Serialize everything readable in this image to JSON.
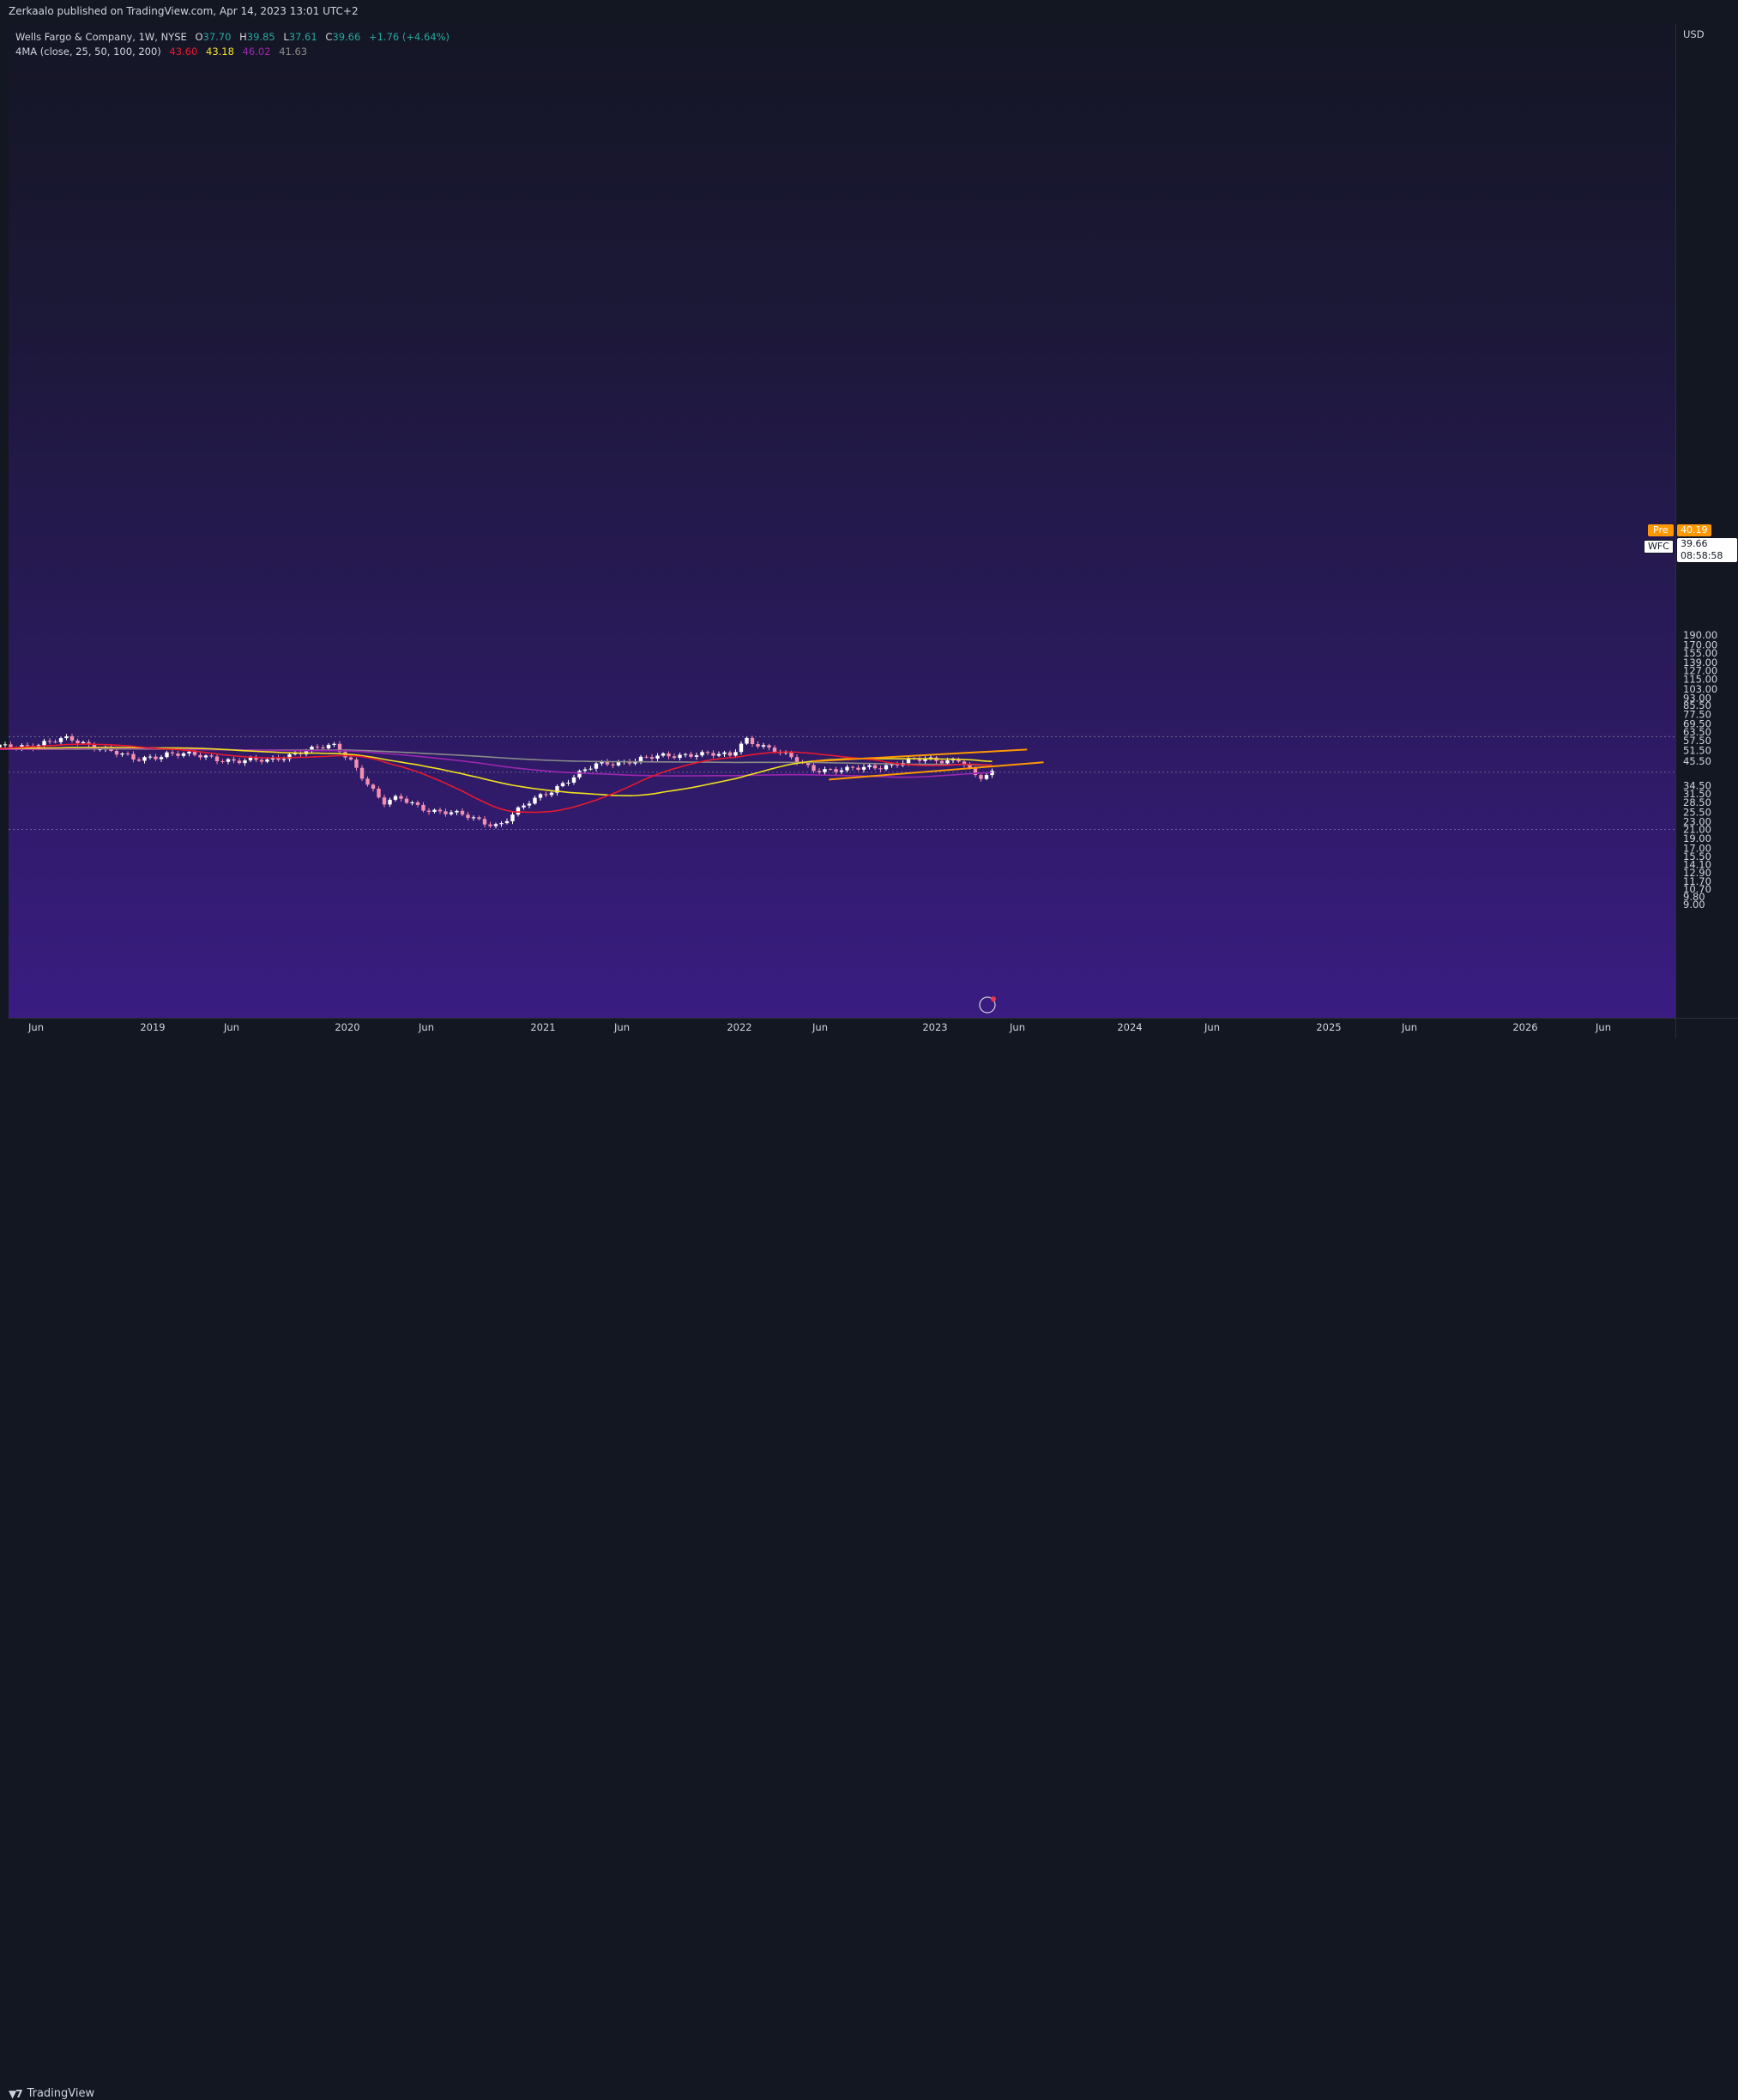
{
  "header": {
    "published": "Zerkaalo published on TradingView.com, Apr 14, 2023 13:01 UTC+2"
  },
  "legend": {
    "symbol": "Wells Fargo & Company, 1W, NYSE",
    "o_label": "O",
    "o_val": "37.70",
    "h_label": "H",
    "h_val": "39.85",
    "l_label": "L",
    "l_val": "37.61",
    "c_label": "C",
    "c_val": "39.66",
    "change": "+1.76 (+4.64%)",
    "ma_label": "4MA (close, 25, 50, 100, 200)",
    "ma_values": [
      "43.60",
      "43.18",
      "46.02",
      "41.63"
    ]
  },
  "colors": {
    "up": "#ffffff",
    "down": "#f48fb1",
    "ma25": "#e8192f",
    "ma50": "#f2e11e",
    "ma100": "#9c27b0",
    "ma200": "#8a8a8a",
    "trend": "#ff9800",
    "pre": "#ff9800"
  },
  "price_scale": {
    "currency": "USD",
    "ticks": [
      "190.00",
      "170.00",
      "155.00",
      "139.00",
      "127.00",
      "115.00",
      "103.00",
      "93.00",
      "85.50",
      "77.50",
      "69.50",
      "63.50",
      "57.50",
      "51.50",
      "45.50",
      "34.50",
      "31.50",
      "28.50",
      "25.50",
      "23.00",
      "21.00",
      "19.00",
      "17.00",
      "15.50",
      "14.10",
      "12.90",
      "11.70",
      "10.70",
      "9.80",
      "9.00"
    ]
  },
  "badges": {
    "pre_label": "Pre",
    "pre_value": "40.19",
    "symbol": "WFC",
    "last_value": "39.66",
    "countdown": "08:58:58"
  },
  "time_scale": [
    "Jun",
    "2019",
    "Jun",
    "2020",
    "Jun",
    "2021",
    "Jun",
    "2022",
    "Jun",
    "2023",
    "Jun",
    "2024",
    "Jun",
    "2025",
    "Jun",
    "2026",
    "Jun"
  ],
  "footer": {
    "brand": "TradingView"
  },
  "chart_data": {
    "type": "candlestick",
    "symbol": "WFC",
    "timeframe": "1W",
    "yscale": "log",
    "ylim": [
      8.5,
      215
    ],
    "x_axis": [
      "Jun",
      "2019",
      "Jun",
      "2020",
      "Jun",
      "2021",
      "Jun",
      "2022",
      "Jun",
      "2023",
      "Jun",
      "2024",
      "Jun",
      "2025",
      "Jun",
      "2026",
      "Jun"
    ],
    "price_path": [
      {
        "date": "2018-04",
        "close": 53.5
      },
      {
        "date": "2018-06",
        "close": 55
      },
      {
        "date": "2018-08",
        "close": 58.5
      },
      {
        "date": "2018-10",
        "close": 53
      },
      {
        "date": "2018-12",
        "close": 46
      },
      {
        "date": "2019-02",
        "close": 50
      },
      {
        "date": "2019-04",
        "close": 48
      },
      {
        "date": "2019-06",
        "close": 46
      },
      {
        "date": "2019-08",
        "close": 45.5
      },
      {
        "date": "2019-10",
        "close": 51
      },
      {
        "date": "2019-12",
        "close": 54
      },
      {
        "date": "2020-01",
        "close": 47
      },
      {
        "date": "2020-03",
        "close": 28
      },
      {
        "date": "2020-04",
        "close": 30
      },
      {
        "date": "2020-06",
        "close": 26
      },
      {
        "date": "2020-08",
        "close": 24.5
      },
      {
        "date": "2020-10",
        "close": 22
      },
      {
        "date": "2020-12",
        "close": 29
      },
      {
        "date": "2021-02",
        "close": 36
      },
      {
        "date": "2021-04",
        "close": 44
      },
      {
        "date": "2021-06",
        "close": 46
      },
      {
        "date": "2021-08",
        "close": 48
      },
      {
        "date": "2021-10",
        "close": 50
      },
      {
        "date": "2021-12",
        "close": 48
      },
      {
        "date": "2022-01",
        "close": 59
      },
      {
        "date": "2022-03",
        "close": 50
      },
      {
        "date": "2022-05",
        "close": 42
      },
      {
        "date": "2022-07",
        "close": 41
      },
      {
        "date": "2022-09",
        "close": 43
      },
      {
        "date": "2022-11",
        "close": 46
      },
      {
        "date": "2023-01",
        "close": 46
      },
      {
        "date": "2023-02",
        "close": 47
      },
      {
        "date": "2023-03",
        "close": 37
      },
      {
        "date": "2023-04",
        "close": 39.66
      }
    ],
    "moving_averages": [
      {
        "length": 25,
        "last": 43.6
      },
      {
        "length": 50,
        "last": 43.18
      },
      {
        "length": 100,
        "last": 46.02
      },
      {
        "length": 200,
        "last": 41.63
      }
    ],
    "horizontal_lines": [
      60.2,
      40.19,
      21.0
    ],
    "trendlines": [
      {
        "from": {
          "date": "2022-05",
          "price": 45.5
        },
        "to": {
          "date": "2023-06",
          "price": 52
        }
      },
      {
        "from": {
          "date": "2022-06",
          "price": 37
        },
        "to": {
          "date": "2023-07",
          "price": 45
        }
      }
    ],
    "grid": false
  }
}
